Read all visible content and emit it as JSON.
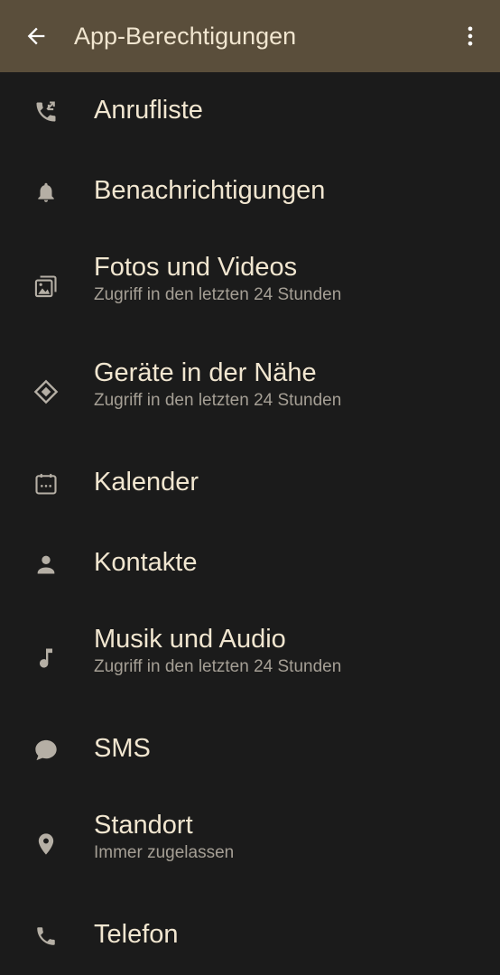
{
  "appbar": {
    "title": "App-Berechtigungen",
    "back_icon": "arrow-back-icon",
    "menu_icon": "more-vert-icon",
    "background_color": "#5a4e3b"
  },
  "permissions": [
    {
      "label": "Anrufliste",
      "subtitle": "",
      "icon": "call-log-icon"
    },
    {
      "label": "Benachrichtigungen",
      "subtitle": "",
      "icon": "bell-icon"
    },
    {
      "label": "Fotos und Videos",
      "subtitle": "Zugriff in den letzten 24 Stunden",
      "icon": "photos-icon"
    },
    {
      "label": "Geräte in der Nähe",
      "subtitle": "Zugriff in den letzten 24 Stunden",
      "icon": "nearby-devices-icon"
    },
    {
      "label": "Kalender",
      "subtitle": "",
      "icon": "calendar-icon"
    },
    {
      "label": "Kontakte",
      "subtitle": "",
      "icon": "person-icon"
    },
    {
      "label": "Musik und Audio",
      "subtitle": "Zugriff in den letzten 24 Stunden",
      "icon": "music-note-icon"
    },
    {
      "label": "SMS",
      "subtitle": "",
      "icon": "sms-icon"
    },
    {
      "label": "Standort",
      "subtitle": "Immer zugelassen",
      "icon": "location-icon"
    },
    {
      "label": "Telefon",
      "subtitle": "",
      "icon": "phone-icon"
    }
  ],
  "colors": {
    "background": "#1b1b1b",
    "primary_text": "#f1e6d0",
    "secondary_text": "#a59f95",
    "icon": "#b5afa5"
  }
}
